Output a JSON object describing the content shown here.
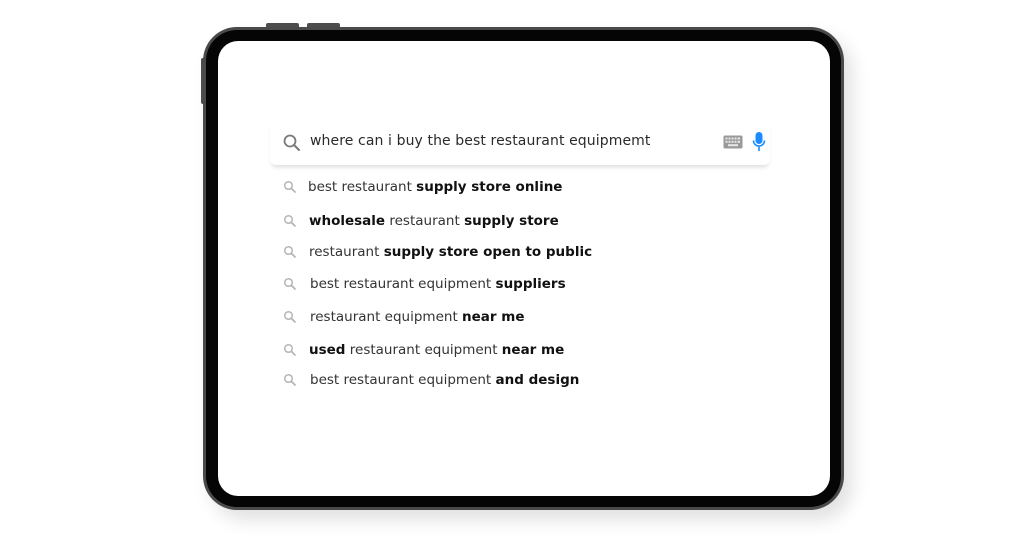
{
  "search": {
    "query": "where can i buy the best restaurant equipmemt",
    "icons": {
      "search": "search-icon",
      "keyboard": "keyboard-icon",
      "microphone": "microphone-icon"
    },
    "mic_color": "#1a8cff"
  },
  "suggestions": [
    {
      "parts": [
        {
          "t": "best restaurant ",
          "b": false
        },
        {
          "t": "supply store online",
          "b": true
        }
      ]
    },
    {
      "parts": [
        {
          "t": "wholesale",
          "b": true
        },
        {
          "t": " restaurant ",
          "b": false
        },
        {
          "t": "supply store",
          "b": true
        }
      ]
    },
    {
      "parts": [
        {
          "t": "restaurant ",
          "b": false
        },
        {
          "t": "supply store open to public",
          "b": true
        }
      ]
    },
    {
      "parts": [
        {
          "t": "best restaurant equipment ",
          "b": false
        },
        {
          "t": "suppliers",
          "b": true
        }
      ]
    },
    {
      "parts": [
        {
          "t": "restaurant equipment ",
          "b": false
        },
        {
          "t": "near me",
          "b": true
        }
      ]
    },
    {
      "parts": [
        {
          "t": "used",
          "b": true
        },
        {
          "t": " restaurant equipment ",
          "b": false
        },
        {
          "t": "near me",
          "b": true
        }
      ]
    },
    {
      "parts": [
        {
          "t": "best restaurant equipment ",
          "b": false
        },
        {
          "t": "and design",
          "b": true
        }
      ]
    }
  ]
}
